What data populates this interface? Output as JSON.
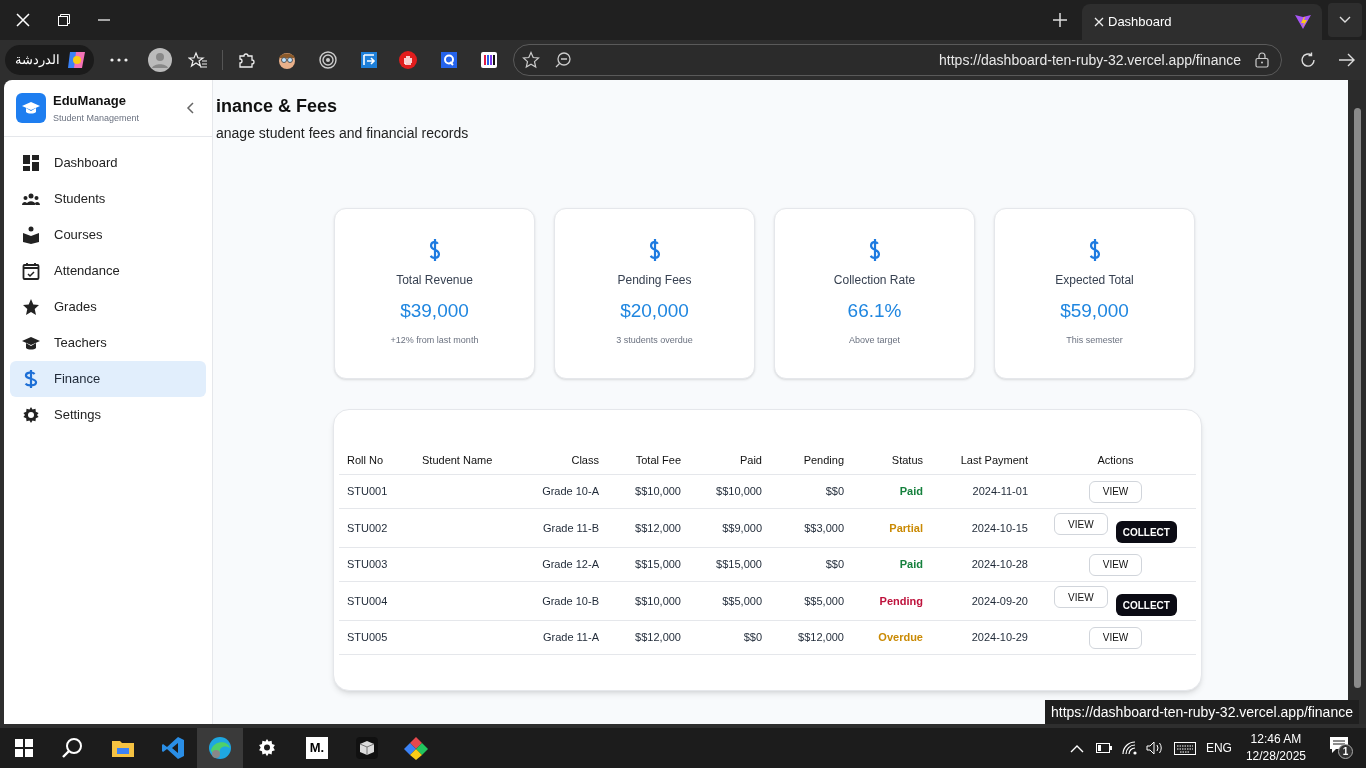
{
  "browser": {
    "tab_title": "Dashboard",
    "chat_label": "الدردشة",
    "url": "https://dashboard-ten-ruby-32.vercel.app/finance",
    "status_url": "https://dashboard-ten-ruby-32.vercel.app/finance"
  },
  "sidebar": {
    "brand": "EduManage",
    "subtitle": "Student Management",
    "items": [
      {
        "label": "Dashboard",
        "selected": false
      },
      {
        "label": "Students",
        "selected": false
      },
      {
        "label": "Courses",
        "selected": false
      },
      {
        "label": "Attendance",
        "selected": false
      },
      {
        "label": "Grades",
        "selected": false
      },
      {
        "label": "Teachers",
        "selected": false
      },
      {
        "label": "Finance",
        "selected": true
      },
      {
        "label": "Settings",
        "selected": false
      }
    ]
  },
  "header": {
    "title": "inance & Fees",
    "subtitle": "anage student fees and financial records"
  },
  "stats": [
    {
      "label": "Total Revenue",
      "value": "$39,000",
      "note": "+12% from last month"
    },
    {
      "label": "Pending Fees",
      "value": "$20,000",
      "note": "3 students overdue"
    },
    {
      "label": "Collection Rate",
      "value": "66.1%",
      "note": "Above target"
    },
    {
      "label": "Expected Total",
      "value": "$59,000",
      "note": "This semester"
    }
  ],
  "table": {
    "columns": [
      "Roll No",
      "Student Name",
      "Class",
      "Total Fee",
      "Paid",
      "Pending",
      "Status",
      "Last Payment",
      "Actions"
    ],
    "rows": [
      {
        "roll": "STU001",
        "class": "Grade 10-A",
        "total_fee": "$$10,000",
        "paid": "$$10,000",
        "pending": "$$0",
        "status": "Paid",
        "color": "#15803d",
        "last_payment": "2024-11-01",
        "actions": [
          {
            "label": "VIEW",
            "kind": "outline"
          }
        ]
      },
      {
        "roll": "STU002",
        "class": "Grade 11-B",
        "total_fee": "$$12,000",
        "paid": "$$9,000",
        "pending": "$$3,000",
        "status": "Partial",
        "color": "#ca8a04",
        "last_payment": "2024-10-15",
        "actions": [
          {
            "label": "VIEW",
            "kind": "outline"
          },
          {
            "label": "COLLECT",
            "kind": "solid"
          }
        ]
      },
      {
        "roll": "STU003",
        "class": "Grade 12-A",
        "total_fee": "$$15,000",
        "paid": "$$15,000",
        "pending": "$$0",
        "status": "Paid",
        "color": "#15803d",
        "last_payment": "2024-10-28",
        "actions": [
          {
            "label": "VIEW",
            "kind": "outline"
          }
        ]
      },
      {
        "roll": "STU004",
        "class": "Grade 10-B",
        "total_fee": "$$10,000",
        "paid": "$$5,000",
        "pending": "$$5,000",
        "status": "Pending",
        "color": "#be123c",
        "last_payment": "2024-09-20",
        "actions": [
          {
            "label": "VIEW",
            "kind": "outline"
          },
          {
            "label": "COLLECT",
            "kind": "solid"
          }
        ]
      },
      {
        "roll": "STU005",
        "class": "Grade 11-A",
        "total_fee": "$$12,000",
        "paid": "$$0",
        "pending": "$$12,000",
        "status": "Overdue",
        "color": "#ca8a04",
        "last_payment": "2024-10-29",
        "actions": [
          {
            "label": "VIEW",
            "kind": "outline"
          }
        ]
      }
    ]
  },
  "taskbar": {
    "app_letter": "M.",
    "language": "ENG",
    "time": "12:46 AM",
    "date": "12/28/2025",
    "notifications": "1"
  }
}
